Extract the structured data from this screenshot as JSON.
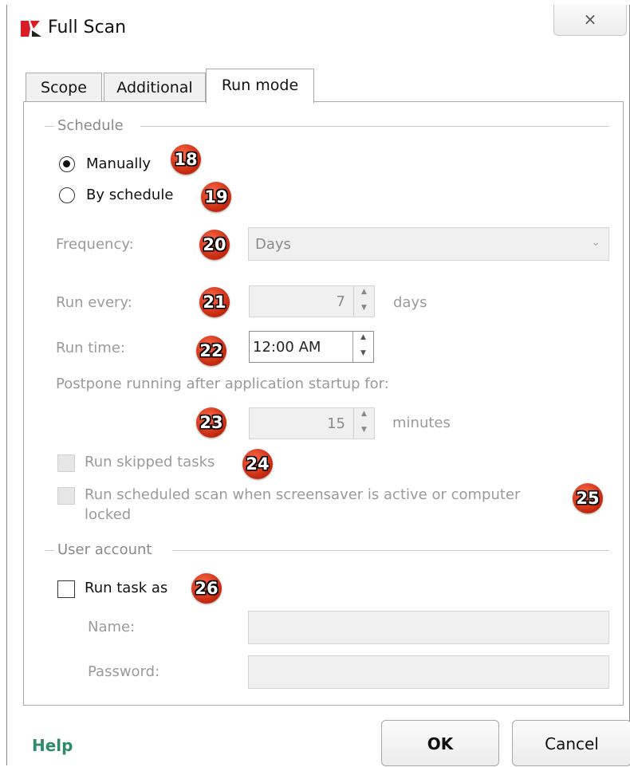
{
  "window": {
    "title": "Full Scan",
    "close_label": "×"
  },
  "tabs": [
    {
      "label": "Scope",
      "active": false
    },
    {
      "label": "Additional",
      "active": false
    },
    {
      "label": "Run mode",
      "active": true
    }
  ],
  "schedule": {
    "header": "Schedule",
    "manually_label": "Manually",
    "manually_selected": true,
    "by_schedule_label": "By schedule",
    "frequency_label": "Frequency:",
    "frequency_value": "Days",
    "run_every_label": "Run every:",
    "run_every_value": "7",
    "run_every_unit": "days",
    "run_time_label": "Run time:",
    "run_time_value": "12:00 AM",
    "postpone_label": "Postpone running after application startup for:",
    "postpone_value": "15",
    "postpone_unit": "minutes",
    "run_skipped_label": "Run skipped tasks",
    "run_scheduled_label_line1": "Run scheduled scan when screensaver is active or computer",
    "run_scheduled_label_line2": "locked"
  },
  "user_account": {
    "header": "User account",
    "run_task_as_label": "Run task as",
    "name_label": "Name:",
    "name_value": "",
    "password_label": "Password:",
    "password_value": ""
  },
  "callouts": [
    "18",
    "19",
    "20",
    "21",
    "22",
    "23",
    "24",
    "25",
    "26"
  ],
  "footer": {
    "help_label": "Help",
    "ok_label": "OK",
    "cancel_label": "Cancel"
  },
  "colors": {
    "help_link": "#2e8b6a",
    "callout": "#d0301a",
    "disabled_text": "#9a9a9a"
  }
}
